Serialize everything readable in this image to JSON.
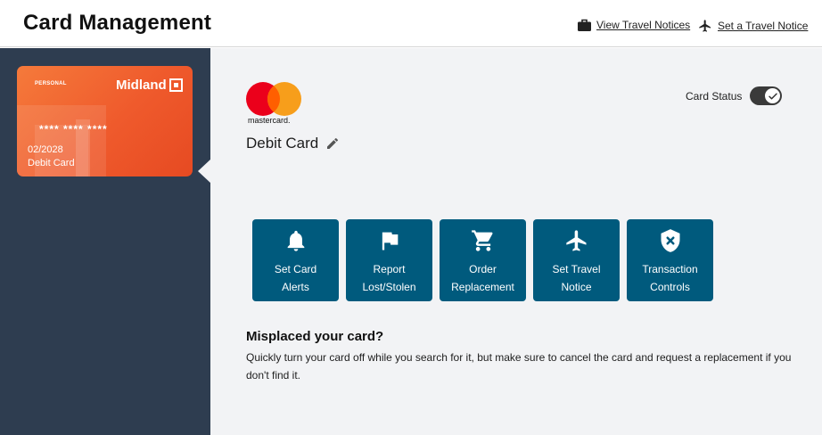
{
  "header": {
    "title": "Card Management",
    "view_travel_notices": "View Travel Notices",
    "set_travel_notice": "Set a Travel Notice"
  },
  "sidebar": {
    "card": {
      "type_label": "PERSONAL",
      "brand": "Midland",
      "number": "**** **** ****",
      "expiry": "02/2028",
      "label": "Debit Card"
    }
  },
  "main": {
    "network_name": "mastercard.",
    "card_name": "Debit Card",
    "card_status_label": "Card Status",
    "card_status_on": true,
    "actions": [
      {
        "label": "Set Card\nAlerts",
        "icon": "bell-icon"
      },
      {
        "label": "Report\nLost/Stolen",
        "icon": "flag-icon"
      },
      {
        "label": "Order\nReplacement",
        "icon": "cart-icon"
      },
      {
        "label": "Set Travel\nNotice",
        "icon": "airplane-icon"
      },
      {
        "label": "Transaction\nControls",
        "icon": "shield-x-icon"
      }
    ],
    "misplaced_title": "Misplaced your card?",
    "misplaced_text": "Quickly turn your card off while you search for it, but make sure to cancel the card and request a replacement if you don't find it."
  },
  "colors": {
    "sidebar_bg": "#2e3d50",
    "card_orange": "#ef5a2c",
    "action_blue": "#005a7d",
    "main_bg": "#f2f3f5"
  }
}
